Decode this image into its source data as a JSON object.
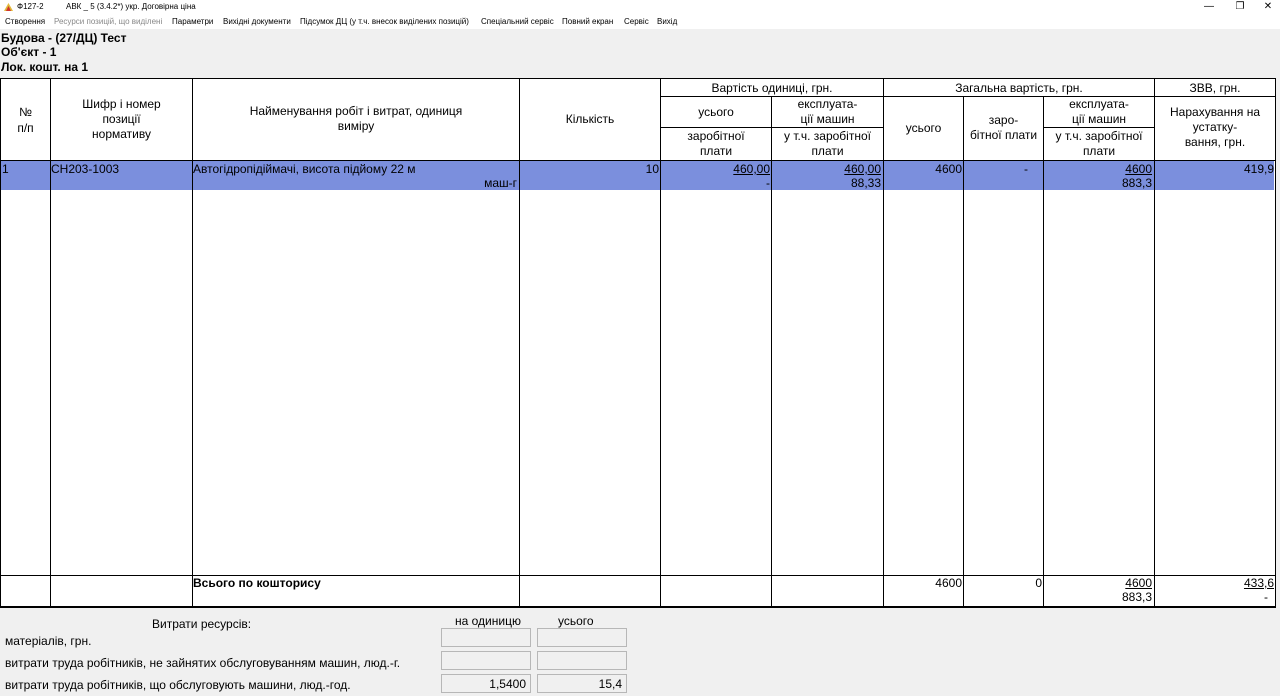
{
  "window": {
    "code": "Ф127-2",
    "title": "АВК _ 5 (3.4.2*) укр. Договірна ціна",
    "min": "—",
    "restore": "❐",
    "close": "✕"
  },
  "menu": [
    "Створення",
    "Ресурси позицій, що виділені",
    "Параметри",
    "Вихідні документи",
    "Підсумок ДЦ (у т.ч. внесок виділених позицій)",
    "Спеціальний сервіс",
    "Повний екран",
    "Сервіс",
    "Вихід"
  ],
  "header": {
    "line1": "Будова - (27/ДЦ) Тест",
    "line2": "Об'єкт - 1",
    "line3": "Лок. кошт. на 1"
  },
  "columns": {
    "num": "№\nп/п",
    "code": "Шифр і номер\nпозиції\nнормативу",
    "name": "Найменування робіт і витрат, одиниця\nвиміру",
    "qty": "Кількість",
    "unit_cost_group": "Вартість одиниці, грн.",
    "total_cost_group": "Загальна вартість, грн.",
    "zvv_group": "ЗВВ, грн.",
    "unit_total": "усього",
    "unit_mach": "експлуата-\nції машин",
    "unit_wage": "заробітної\nплати",
    "unit_mach_wage": "у т.ч. заробітної\nплати",
    "total_total": "усього",
    "total_wage": "заро-\nбітної плати",
    "total_mach": "експлуата-\nції машин",
    "total_mach_wage": "у т.ч. заробітної\nплати",
    "zvv": "Нарахування на\nустатку-\nвання, грн."
  },
  "row": {
    "num": "1",
    "code": "СН203-1003",
    "name": "Автогідропідіймачі, висота підйому 22 м",
    "unit": "маш-г",
    "qty": "10",
    "unit_total": "460,00",
    "unit_wage": "-",
    "unit_mach": "460,00",
    "unit_mach_wage": "88,33",
    "total_total": "4600",
    "total_wage": "-",
    "total_mach": "4600",
    "total_mach_wage": "883,3",
    "zvv": "419,9"
  },
  "summary": {
    "label": "Всього по кошторису",
    "total_total": "4600",
    "total_wage": "0",
    "total_mach": "4600",
    "total_mach_wage": "883,3",
    "zvv": "433,6",
    "zvv2": "-"
  },
  "resources": {
    "title": "Витрати ресурсів:",
    "col_unit": "на одиницю",
    "col_total": "усього",
    "rows": [
      {
        "label": "матеріалів, грн.",
        "unit": "",
        "total": ""
      },
      {
        "label": "витрати труда робітників, не зайнятих обслуговуванням машин, люд.-г.",
        "unit": "",
        "total": ""
      },
      {
        "label": "витрати труда робітників, що обслуговують машини, люд.-год.",
        "unit": "1,5400",
        "total": "15,4"
      }
    ]
  }
}
